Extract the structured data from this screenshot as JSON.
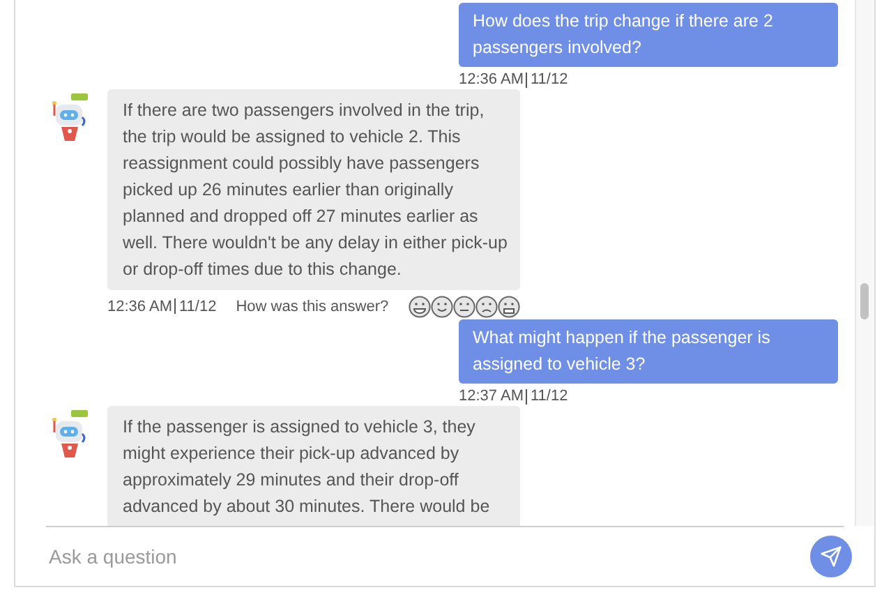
{
  "messages": [
    {
      "kind": "user",
      "text": "How does the trip change if there are 2 passengers involved?",
      "time": "12:36 AM",
      "date": "11/12"
    },
    {
      "kind": "bot",
      "text": "If there are two passengers involved in the trip, the trip would be assigned to vehicle 2. This reassignment could possibly have passengers picked up 26 minutes earlier than originally planned and dropped off 27 minutes earlier as well. There wouldn't be any delay in either pick-up or drop-off times due to this change.",
      "time": "12:36 AM",
      "date": "11/12",
      "feedback_prompt": "How was this answer?"
    },
    {
      "kind": "user",
      "text": "What might happen if the passenger is assigned to vehicle 3?",
      "time": "12:37 AM",
      "date": "11/12"
    },
    {
      "kind": "bot",
      "text": "If the passenger is assigned to vehicle 3, they might experience their pick-up advanced by approximately 29 minutes and their drop-off advanced by about 30 minutes. There would be"
    }
  ],
  "input": {
    "placeholder": "Ask a question"
  }
}
